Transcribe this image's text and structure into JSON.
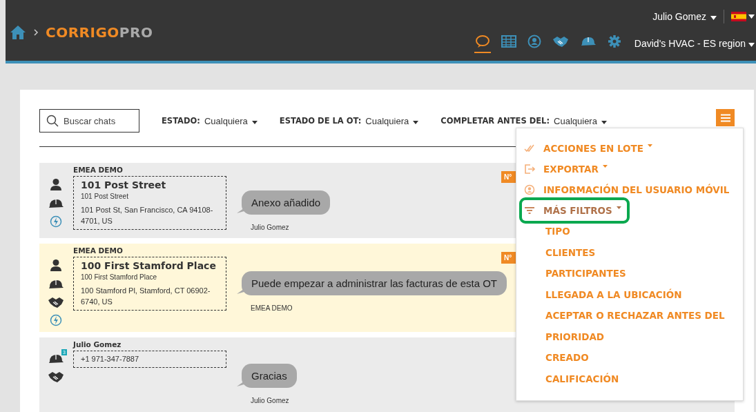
{
  "header": {
    "brand": {
      "first": "CORRIGO",
      "second": "PRO"
    },
    "user": "Julio Gomez",
    "region": "David's HVAC - ES region",
    "nav_icons": [
      {
        "kind": "chat",
        "selected": true
      },
      {
        "kind": "table",
        "selected": false
      },
      {
        "kind": "user",
        "selected": false
      },
      {
        "kind": "handshake",
        "selected": false
      },
      {
        "kind": "helmet",
        "selected": false
      },
      {
        "kind": "gear",
        "selected": false
      }
    ]
  },
  "filters": {
    "search": {
      "placeholder": "Buscar chats"
    },
    "dropdowns": [
      {
        "label": "ESTADO:",
        "value": "Cualquiera"
      },
      {
        "label": "ESTADO DE LA OT:",
        "value": "Cualquiera"
      },
      {
        "label": "COMPLETAR ANTES DEL:",
        "value": "Cualquiera"
      }
    ]
  },
  "chats": [
    {
      "sender": "EMEA DEMO",
      "highlighted": false,
      "badge": "N°",
      "icons": [
        {
          "kind": "person"
        },
        {
          "kind": "helmet"
        },
        {
          "kind": "bolt"
        }
      ],
      "title": "101 Post Street",
      "subtitle": "101 Post Street",
      "address": "101 Post St, San Francisco, CA 94108-4701, US",
      "message": "Anexo añadido",
      "author": "Julio Gomez"
    },
    {
      "sender": "EMEA DEMO",
      "highlighted": true,
      "badge": "N°",
      "icons": [
        {
          "kind": "person"
        },
        {
          "kind": "helmet"
        },
        {
          "kind": "handshake"
        },
        {
          "kind": "bolt"
        }
      ],
      "title": "100 First Stamford Place",
      "subtitle": "100 First Stamford Place",
      "address": "100 Stamford Pl, Stamford, CT 06902-6740, US",
      "message": "Puede empezar a administrar las facturas de esta OT",
      "author": "EMEA DEMO"
    },
    {
      "sender": "Julio Gomez",
      "highlighted": false,
      "icons": [
        {
          "kind": "helmet",
          "count": "3"
        },
        {
          "kind": "handshake"
        }
      ],
      "phone": "+1 971-347-7887",
      "message": "Gracias",
      "author": "Julio Gomez"
    }
  ],
  "menu": {
    "items": [
      {
        "label": "ACCIONES EN LOTE",
        "kind": "checks",
        "caret": true,
        "highlighted": false
      },
      {
        "label": "EXPORTAR",
        "kind": "export",
        "caret": true,
        "highlighted": false
      },
      {
        "label": "INFORMACIÓN DEL USUARIO MÓVIL",
        "kind": "user",
        "caret": false,
        "highlighted": false
      },
      {
        "label": "MÁS FILTROS",
        "kind": "filter",
        "caret": true,
        "highlighted": true
      }
    ],
    "subitems": [
      "TIPO",
      "CLIENTES",
      "PARTICIPANTES",
      "LLEGADA A LA UBICACIÓN",
      "ACEPTAR O RECHAZAR ANTES DEL",
      "PRIORIDAD",
      "CREADO",
      "CALIFICACIÓN"
    ]
  }
}
